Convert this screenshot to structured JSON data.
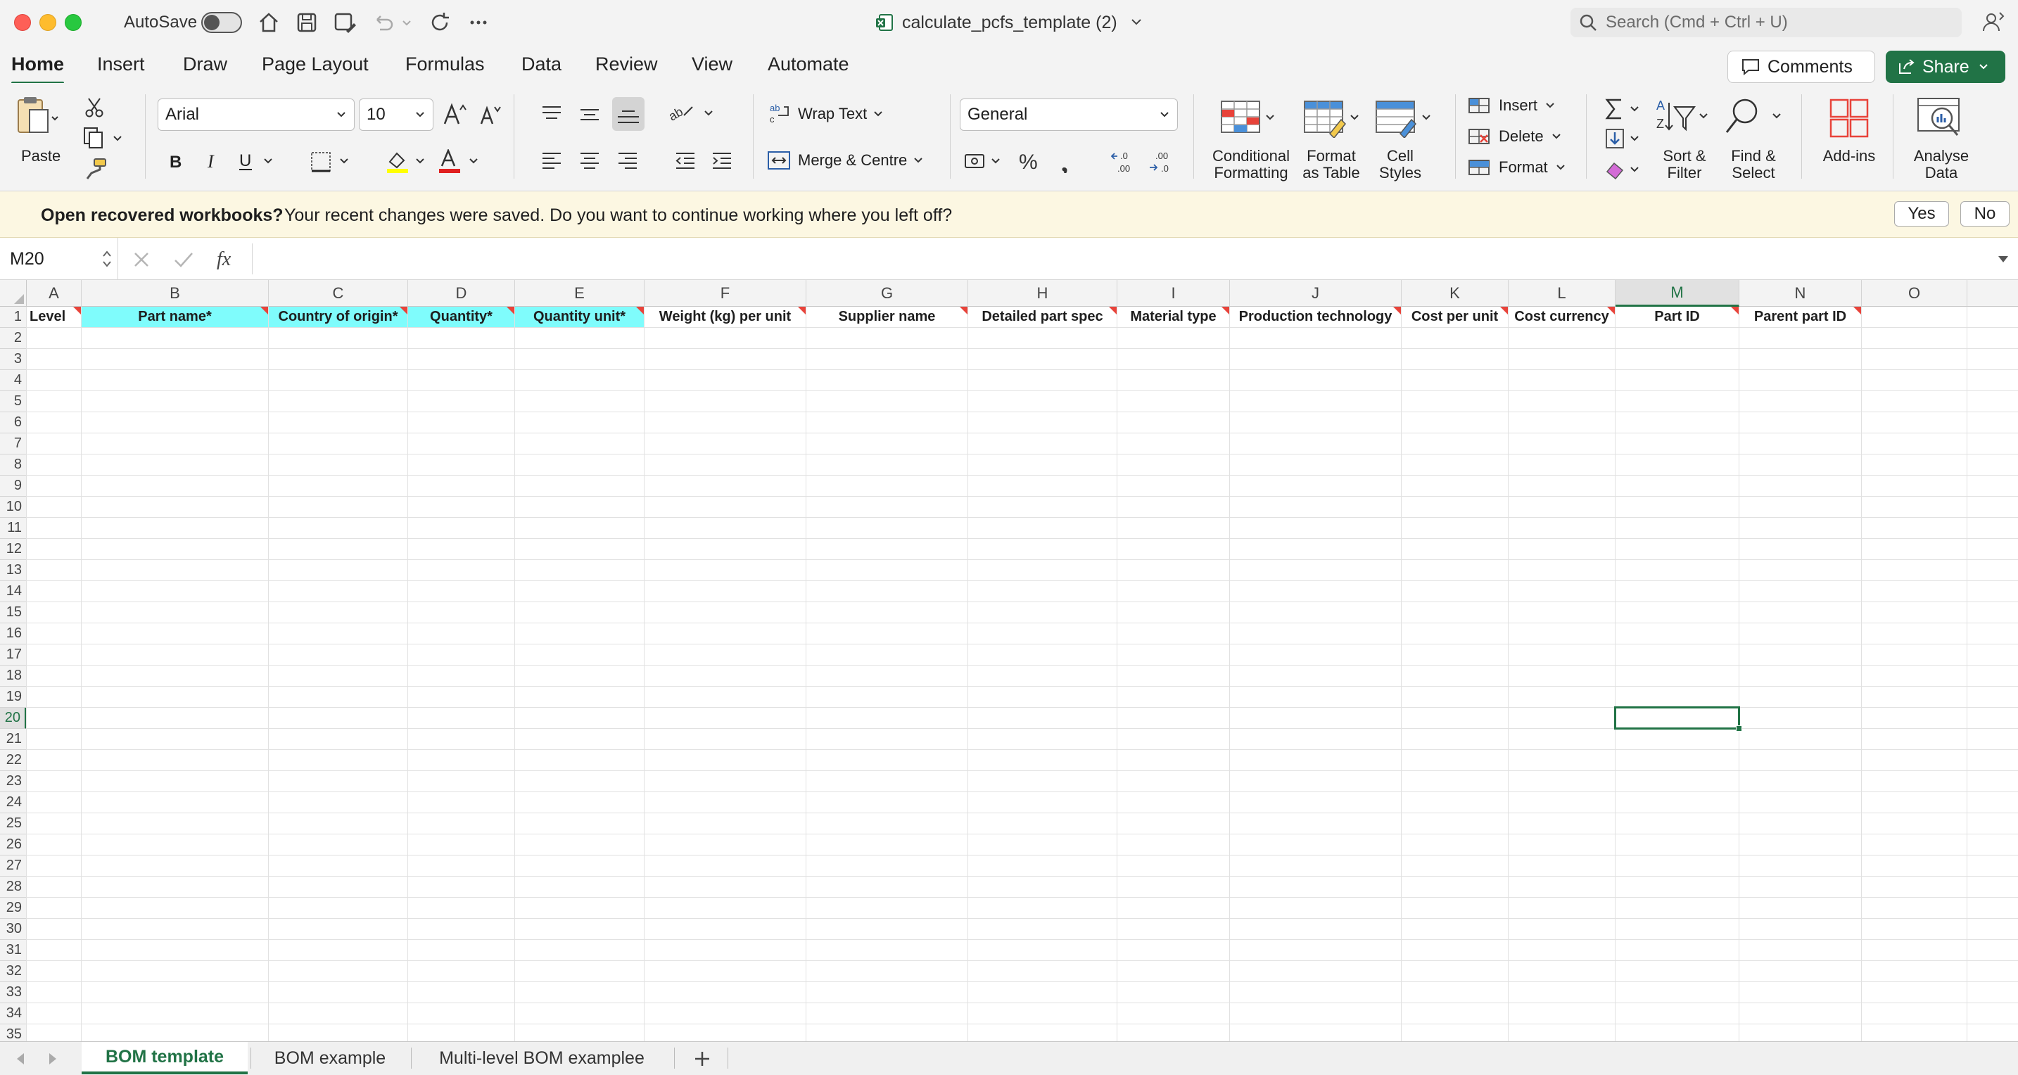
{
  "window": {
    "autosave_label": "AutoSave",
    "filename": "calculate_pcfs_template (2)",
    "search_placeholder": "Search (Cmd + Ctrl + U)"
  },
  "tabs": [
    "Home",
    "Insert",
    "Draw",
    "Page Layout",
    "Formulas",
    "Data",
    "Review",
    "View",
    "Automate"
  ],
  "active_tab": "Home",
  "actions": {
    "comments": "Comments",
    "share": "Share"
  },
  "ribbon": {
    "paste": "Paste",
    "font_name": "Arial",
    "font_size": "10",
    "wrap_text": "Wrap Text",
    "merge_centre": "Merge & Centre",
    "number_format": "General",
    "conditional_formatting": [
      "Conditional",
      "Formatting"
    ],
    "format_as_table": [
      "Format",
      "as Table"
    ],
    "cell_styles": [
      "Cell",
      "Styles"
    ],
    "insert": "Insert",
    "delete": "Delete",
    "format": "Format",
    "sort_filter": [
      "Sort &",
      "Filter"
    ],
    "find_select": [
      "Find &",
      "Select"
    ],
    "add_ins": "Add-ins",
    "analyse_data": [
      "Analyse",
      "Data"
    ]
  },
  "message_bar": {
    "title": "Open recovered workbooks?",
    "text": "Your recent changes were saved. Do you want to continue working where you left off?",
    "yes": "Yes",
    "no": "No"
  },
  "formula_bar": {
    "name_box": "M20",
    "formula": ""
  },
  "sheet": {
    "columns": [
      "A",
      "B",
      "C",
      "D",
      "E",
      "F",
      "G",
      "H",
      "I",
      "J",
      "K",
      "L",
      "M",
      "N",
      "O"
    ],
    "headers": [
      "Level",
      "Part name*",
      "Country of origin*",
      "Quantity*",
      "Quantity unit*",
      "Weight (kg) per unit",
      "Supplier name",
      "Detailed part spec",
      "Material type",
      "Production technology",
      "Cost per unit",
      "Cost currency",
      "Part ID",
      "Parent part ID",
      ""
    ],
    "highlighted_header_cols": [
      "B",
      "C",
      "D",
      "E"
    ],
    "commented_header_cols": [
      "A",
      "B",
      "C",
      "D",
      "E",
      "F",
      "G",
      "H",
      "I",
      "J",
      "K",
      "L",
      "M",
      "N"
    ],
    "row_count": 35,
    "selected_cell": "M20",
    "selected_column": "M",
    "selected_row": 20,
    "colors": {
      "header_highlight": "#7ffcfc",
      "selection": "#217346",
      "comment": "#e8433a"
    }
  },
  "sheet_tabs": [
    "BOM template",
    "BOM example",
    "Multi-level BOM examplee"
  ],
  "active_sheet": "BOM template"
}
